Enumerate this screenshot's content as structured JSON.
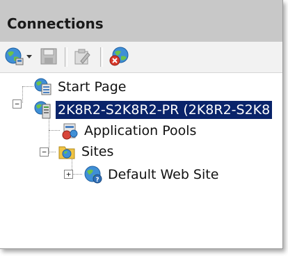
{
  "panel": {
    "title": "Connections"
  },
  "toolbar": {
    "buttons": [
      {
        "icon": "connect-globe-icon"
      },
      {
        "icon": "dropdown-arrow-icon"
      },
      {
        "icon": "save-icon"
      },
      {
        "icon": "edit-icon"
      },
      {
        "icon": "disconnect-icon"
      }
    ]
  },
  "tree": {
    "items": [
      {
        "label": "Start Page",
        "icon": "start-page-icon"
      },
      {
        "label": "2K8R2-S2K8R2-PR (2K8R2-S2K8",
        "icon": "server-icon",
        "expanded": true,
        "selected": true
      },
      {
        "label": "Application Pools",
        "icon": "application-pools-icon"
      },
      {
        "label": "Sites",
        "icon": "sites-folder-icon",
        "expanded": true
      },
      {
        "label": "Default Web Site",
        "icon": "website-globe-icon",
        "expanded": false
      }
    ]
  },
  "colors": {
    "title_bar": "#c8c8c8",
    "selection": "#0a246a",
    "selection_text": "#ffffff"
  }
}
